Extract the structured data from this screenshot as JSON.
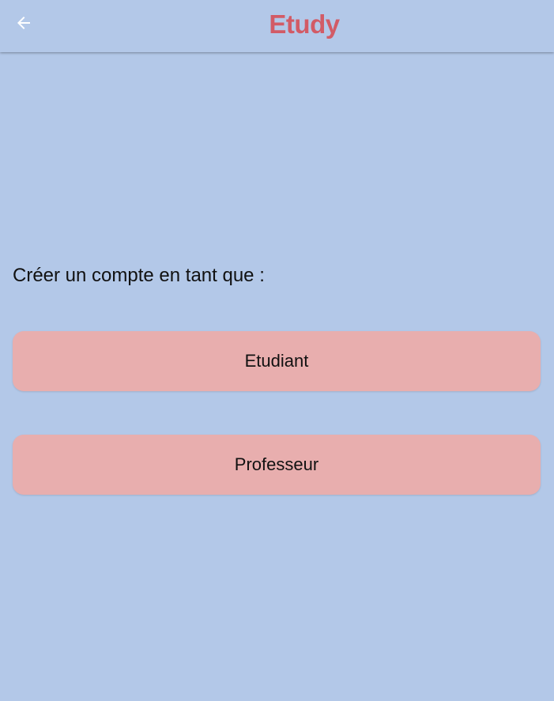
{
  "app_bar": {
    "back_icon": "arrow-left-icon",
    "title": "Etudy",
    "title_color": "#d25b66",
    "background": "#b3c8e8"
  },
  "main": {
    "prompt": "Créer un compte en tant que :",
    "buttons": [
      {
        "label": "Etudiant"
      },
      {
        "label": "Professeur"
      }
    ],
    "button_color": "#e8aeae"
  }
}
